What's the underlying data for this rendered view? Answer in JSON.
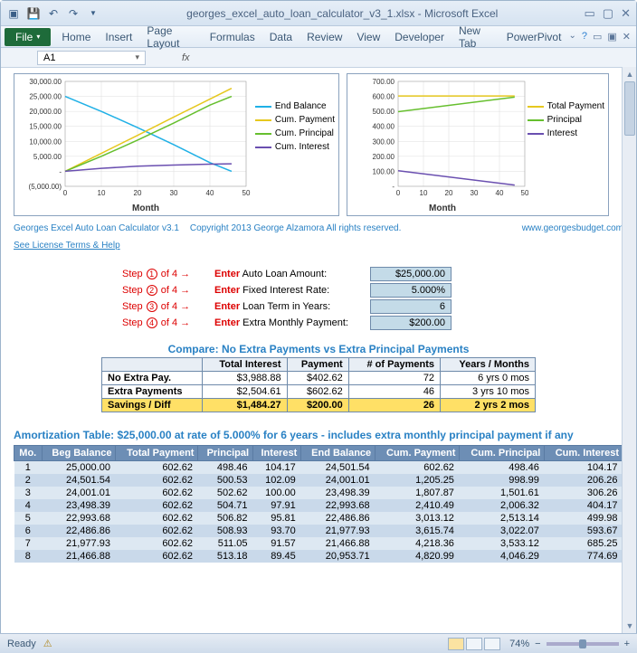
{
  "title": "georges_excel_auto_loan_calculator_v3_1.xlsx - Microsoft Excel",
  "ribbon": {
    "file": "File",
    "tabs": [
      "Home",
      "Insert",
      "Page Layout",
      "Formulas",
      "Data",
      "Review",
      "View",
      "Developer",
      "New Tab",
      "PowerPivot"
    ]
  },
  "namebox": {
    "cell": "A1",
    "fx": "fx"
  },
  "copyright": {
    "left1": "Georges Excel Auto Loan Calculator v3.1",
    "left2": "Copyright 2013   George Alzamora   All rights reserved.",
    "link": "See License Terms & Help",
    "right": "www.georgesbudget.com"
  },
  "inputs": {
    "steps": [
      {
        "n": "1",
        "label_pre": "Enter",
        "label": " Auto Loan Amount:",
        "value": "$25,000.00"
      },
      {
        "n": "2",
        "label_pre": "Enter",
        "label": " Fixed Interest Rate:",
        "value": "5.000%"
      },
      {
        "n": "3",
        "label_pre": "Enter",
        "label": " Loan Term in Years:",
        "value": "6"
      },
      {
        "n": "4",
        "label_pre": "Enter",
        "label": " Extra Monthly Payment:",
        "value": "$200.00"
      }
    ],
    "step_word": "Step",
    "of": "of 4 →"
  },
  "compare": {
    "title": "Compare: No Extra Payments vs Extra Principal Payments",
    "headers": [
      "Total Interest",
      "Payment",
      "# of Payments",
      "Years / Months"
    ],
    "rows": [
      {
        "label": "No Extra Pay.",
        "cells": [
          "$3,988.88",
          "$402.62",
          "72",
          "6 yrs 0 mos"
        ]
      },
      {
        "label": "Extra Payments",
        "cells": [
          "$2,504.61",
          "$602.62",
          "46",
          "3 yrs 10 mos"
        ]
      },
      {
        "label": "Savings / Diff",
        "cells": [
          "$1,484.27",
          "$200.00",
          "26",
          "2 yrs 2 mos"
        ]
      }
    ]
  },
  "amort": {
    "title": "Amortization Table:  $25,000.00 at rate of 5.000% for 6 years - includes extra monthly principal payment if any",
    "headers": [
      "Mo.",
      "Beg Balance",
      "Total Payment",
      "Principal",
      "Interest",
      "End Balance",
      "Cum. Payment",
      "Cum. Principal",
      "Cum. Interest"
    ],
    "rows": [
      [
        "1",
        "25,000.00",
        "602.62",
        "498.46",
        "104.17",
        "24,501.54",
        "602.62",
        "498.46",
        "104.17"
      ],
      [
        "2",
        "24,501.54",
        "602.62",
        "500.53",
        "102.09",
        "24,001.01",
        "1,205.25",
        "998.99",
        "206.26"
      ],
      [
        "3",
        "24,001.01",
        "602.62",
        "502.62",
        "100.00",
        "23,498.39",
        "1,807.87",
        "1,501.61",
        "306.26"
      ],
      [
        "4",
        "23,498.39",
        "602.62",
        "504.71",
        "97.91",
        "22,993.68",
        "2,410.49",
        "2,006.32",
        "404.17"
      ],
      [
        "5",
        "22,993.68",
        "602.62",
        "506.82",
        "95.81",
        "22,486.86",
        "3,013.12",
        "2,513.14",
        "499.98"
      ],
      [
        "6",
        "22,486.86",
        "602.62",
        "508.93",
        "93.70",
        "21,977.93",
        "3,615.74",
        "3,022.07",
        "593.67"
      ],
      [
        "7",
        "21,977.93",
        "602.62",
        "511.05",
        "91.57",
        "21,466.88",
        "4,218.36",
        "3,533.12",
        "685.25"
      ],
      [
        "8",
        "21,466.88",
        "602.62",
        "513.18",
        "89.45",
        "20,953.71",
        "4,820.99",
        "4,046.29",
        "774.69"
      ]
    ]
  },
  "status": {
    "ready": "Ready",
    "zoom": "74%"
  },
  "chart_data": [
    {
      "type": "line",
      "xlabel": "Month",
      "xlim": [
        0,
        50
      ],
      "xticks": [
        0,
        10,
        20,
        30,
        40,
        50
      ],
      "ylim": [
        -5000,
        30000
      ],
      "yticks": [
        -5000,
        0,
        5000,
        10000,
        15000,
        20000,
        25000,
        30000
      ],
      "ytick_labels": [
        "(5,000.00)",
        "-",
        "5,000.00",
        "10,000.00",
        "15,000.00",
        "20,000.00",
        "25,000.00",
        "30,000.00"
      ],
      "series": [
        {
          "name": "End Balance",
          "color": "#1fb0e6",
          "x": [
            0,
            10,
            20,
            30,
            40,
            46
          ],
          "y": [
            25000,
            20000,
            14600,
            8900,
            2900,
            0
          ]
        },
        {
          "name": "Cum. Payment",
          "color": "#e6c81f",
          "x": [
            0,
            10,
            20,
            30,
            40,
            46
          ],
          "y": [
            0,
            6000,
            12000,
            18100,
            24100,
            27700
          ]
        },
        {
          "name": "Cum. Principal",
          "color": "#66bf2e",
          "x": [
            0,
            10,
            20,
            30,
            40,
            46
          ],
          "y": [
            0,
            5000,
            10400,
            16100,
            22100,
            25000
          ]
        },
        {
          "name": "Cum. Interest",
          "color": "#6a4fb0",
          "x": [
            0,
            10,
            20,
            30,
            40,
            46
          ],
          "y": [
            0,
            1000,
            1700,
            2100,
            2400,
            2500
          ]
        }
      ]
    },
    {
      "type": "line",
      "xlabel": "Month",
      "xlim": [
        0,
        50
      ],
      "xticks": [
        0,
        10,
        20,
        30,
        40,
        50
      ],
      "ylim": [
        0,
        700
      ],
      "yticks": [
        0,
        100,
        200,
        300,
        400,
        500,
        600,
        700
      ],
      "ytick_labels": [
        "-",
        "100.00",
        "200.00",
        "300.00",
        "400.00",
        "500.00",
        "600.00",
        "700.00"
      ],
      "series": [
        {
          "name": "Total Payment",
          "color": "#e6c81f",
          "x": [
            0,
            46
          ],
          "y": [
            602.62,
            602.62
          ]
        },
        {
          "name": "Principal",
          "color": "#66bf2e",
          "x": [
            0,
            46
          ],
          "y": [
            498,
            595
          ]
        },
        {
          "name": "Interest",
          "color": "#6a4fb0",
          "x": [
            0,
            46
          ],
          "y": [
            104,
            8
          ]
        }
      ]
    }
  ]
}
